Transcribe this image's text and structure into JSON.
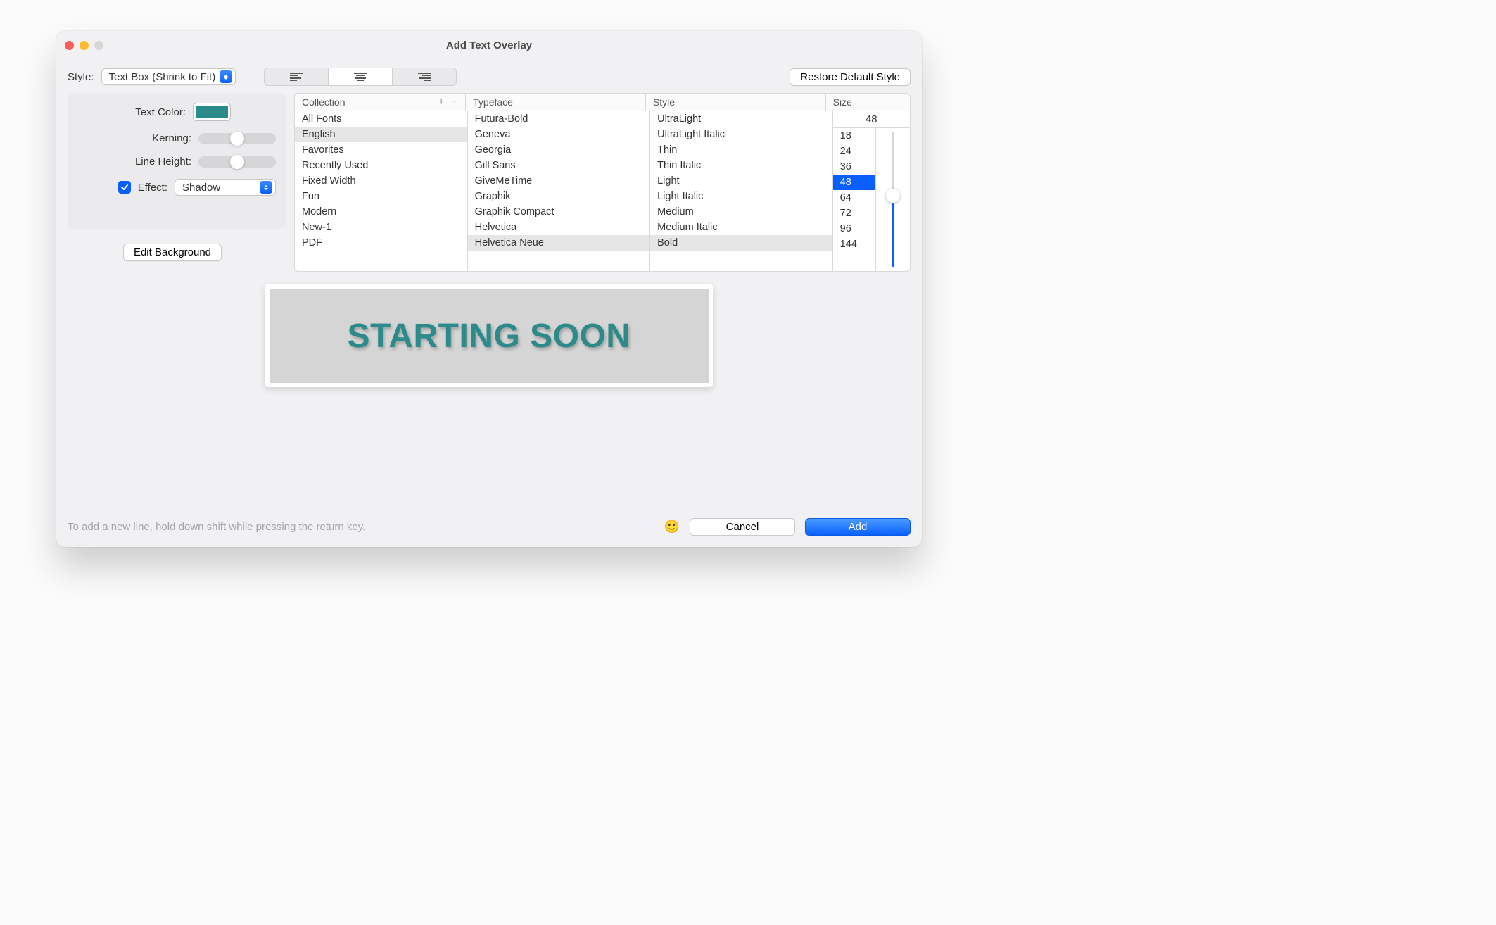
{
  "window": {
    "title": "Add Text Overlay"
  },
  "toolbar": {
    "style_label": "Style:",
    "style_value": "Text Box (Shrink to Fit)",
    "restore_label": "Restore Default Style"
  },
  "left_panel": {
    "text_color_label": "Text Color:",
    "text_color": "#2b8a8a",
    "kerning_label": "Kerning:",
    "line_height_label": "Line Height:",
    "effect_label": "Effect:",
    "effect_checked": true,
    "effect_value": "Shadow",
    "edit_background_label": "Edit Background"
  },
  "font_table": {
    "headers": {
      "collection": "Collection",
      "typeface": "Typeface",
      "style": "Style",
      "size": "Size"
    },
    "collections": [
      "All Fonts",
      "English",
      "Favorites",
      "Recently Used",
      "Fixed Width",
      "Fun",
      "Modern",
      "New-1",
      "PDF"
    ],
    "collection_selected": "English",
    "typefaces": [
      "Futura-Bold",
      "Geneva",
      "Georgia",
      "Gill Sans",
      "GiveMeTime",
      "Graphik",
      "Graphik Compact",
      "Helvetica",
      "Helvetica Neue"
    ],
    "typeface_selected": "Helvetica Neue",
    "styles": [
      "UltraLight",
      "UltraLight Italic",
      "Thin",
      "Thin Italic",
      "Light",
      "Light Italic",
      "Medium",
      "Medium Italic",
      "Bold"
    ],
    "style_selected": "Bold",
    "size_value": "48",
    "sizes": [
      "18",
      "24",
      "36",
      "48",
      "64",
      "72",
      "96",
      "144"
    ],
    "size_selected": "48"
  },
  "preview": {
    "text": "STARTING SOON"
  },
  "footer": {
    "hint": "To add a new line, hold down shift while pressing the return key.",
    "cancel": "Cancel",
    "add": "Add"
  }
}
